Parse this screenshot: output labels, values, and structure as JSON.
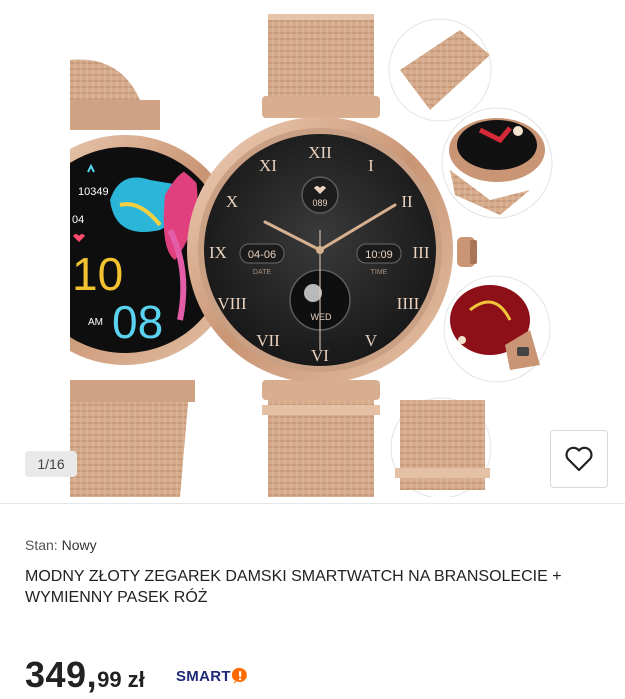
{
  "gallery": {
    "counter": "1/16",
    "main_watch": {
      "date_value": "04-06",
      "date_label": "DATE",
      "time_value": "10:09",
      "time_label": "TIME",
      "heart_rate": "089",
      "day_label": "WED",
      "numerals": [
        "XII",
        "I",
        "II",
        "III",
        "IIII",
        "V",
        "VI",
        "VII",
        "VIII",
        "IX",
        "X",
        "XI"
      ]
    },
    "left_watch": {
      "steps": "10349",
      "heart": "04",
      "hour": "10",
      "minute": "08",
      "ampm": "AM"
    }
  },
  "product": {
    "condition_label": "Stan:",
    "condition_value": "Nowy",
    "title": "MODNY ZŁOTY ZEGAREK DAMSKI SMARTWATCH NA BRANSOLECIE + WYMIENNY PASEK RÓŻ",
    "price_int": "349,",
    "price_dec": "99",
    "currency": "zł",
    "smart_label": "SMART"
  },
  "colors": {
    "rose_gold": "#d9ae8f",
    "rose_gold_dark": "#b98a6c",
    "dial": "#232323",
    "smart_navy": "#1e2a78",
    "smart_orange": "#ff6b00"
  }
}
